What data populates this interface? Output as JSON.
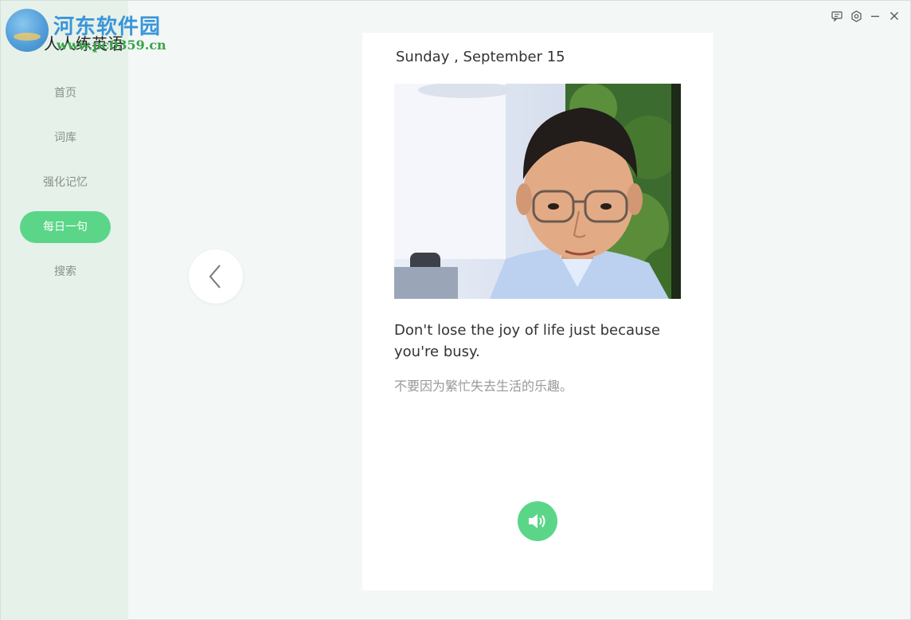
{
  "watermark": {
    "title": "河东软件园",
    "url": "www.pc0359.cn"
  },
  "app": {
    "name": "人人练英语"
  },
  "sidebar": {
    "items": [
      {
        "label": "首页",
        "active": false
      },
      {
        "label": "词库",
        "active": false
      },
      {
        "label": "强化记忆",
        "active": false
      },
      {
        "label": "每日一句",
        "active": true
      },
      {
        "label": "搜索",
        "active": false
      }
    ]
  },
  "window_controls": {
    "icons": [
      "feedback-icon",
      "settings-icon",
      "minimize-icon",
      "close-icon"
    ]
  },
  "daily": {
    "date": "Sunday , September 15",
    "sentence_en": "Don't lose the joy of life just because you're busy.",
    "sentence_zh": "不要因为繁忙失去生活的乐趣。"
  },
  "colors": {
    "accent": "#5bd688",
    "sidebar_bg": "#e6f1ea",
    "page_bg": "#f3f7f6"
  }
}
